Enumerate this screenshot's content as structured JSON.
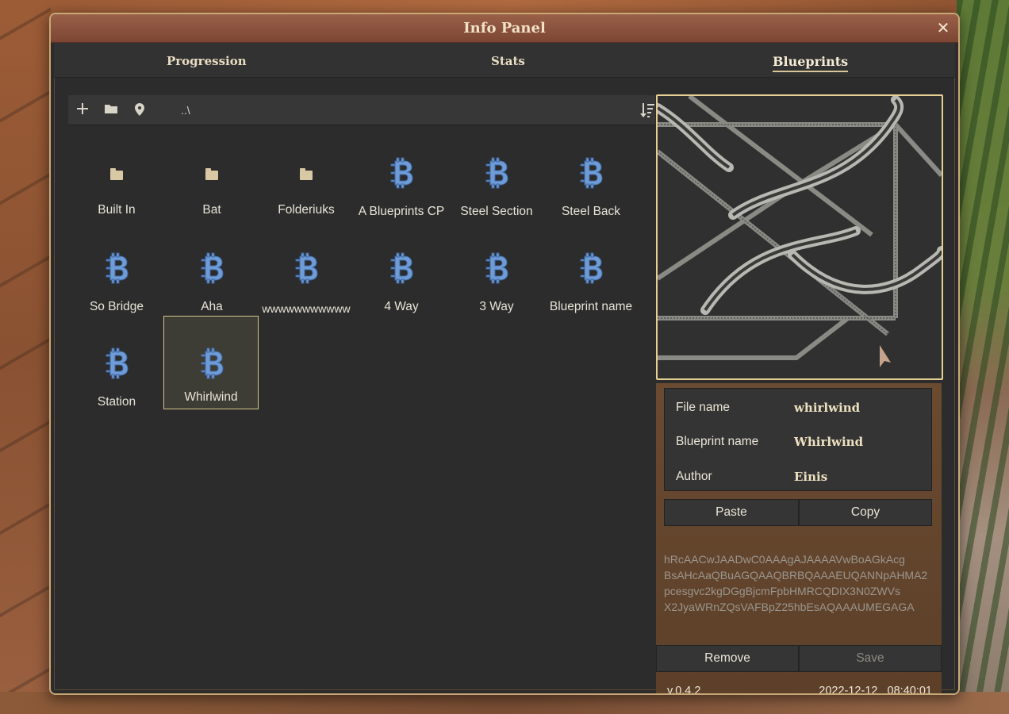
{
  "window": {
    "title": "Info Panel"
  },
  "tabs": [
    {
      "label": "Progression",
      "active": false
    },
    {
      "label": "Stats",
      "active": false
    },
    {
      "label": "Blueprints",
      "active": true
    }
  ],
  "toolbar": {
    "path": "..\\",
    "icons": [
      "add-icon",
      "folder-icon",
      "location-pin-icon",
      "sort-icon"
    ]
  },
  "items": [
    {
      "label": "Built In",
      "type": "folder"
    },
    {
      "label": "Bat",
      "type": "folder"
    },
    {
      "label": "Folderiuks",
      "type": "folder"
    },
    {
      "label": "A Blueprints CP",
      "type": "blueprint"
    },
    {
      "label": "Steel Section",
      "type": "blueprint"
    },
    {
      "label": "Steel Back",
      "type": "blueprint"
    },
    {
      "label": "So Bridge",
      "type": "blueprint"
    },
    {
      "label": "Aha",
      "type": "blueprint"
    },
    {
      "label": "wwwwwwwwwww",
      "type": "blueprint"
    },
    {
      "label": "4 Way",
      "type": "blueprint"
    },
    {
      "label": "3 Way",
      "type": "blueprint"
    },
    {
      "label": "Blueprint name",
      "type": "blueprint"
    },
    {
      "label": "Station",
      "type": "blueprint"
    },
    {
      "label": "Whirlwind",
      "type": "blueprint",
      "selected": true
    }
  ],
  "details": {
    "file_name_label": "File name",
    "file_name": "whirlwind",
    "blueprint_name_label": "Blueprint name",
    "blueprint_name": "Whirlwind",
    "author_label": "Author",
    "author": "Einis"
  },
  "actions": {
    "paste": "Paste",
    "copy": "Copy",
    "remove": "Remove",
    "save": "Save"
  },
  "code_lines": [
    "hRcAACwJAADwC0AAAgAJAAAAVwBoAGkAcg",
    "BsAHcAaQBuAGQAAQBRBQAAAEUQANNpAHMA2",
    "pcesgvc2kgDGgBjcmFpbHMRCQDIX3N0ZWVs",
    "X2JyaWRnZQsVAFBpZ25hbEsAQAAAUMEGAGA"
  ],
  "footer": {
    "version": "v.0.4.2",
    "date": "2022-12-12",
    "time": "08:40:01"
  },
  "colors": {
    "accent": "#d8c38e",
    "blueprint_icon": "#6f9bd6",
    "title_bar": "#8a5240"
  }
}
